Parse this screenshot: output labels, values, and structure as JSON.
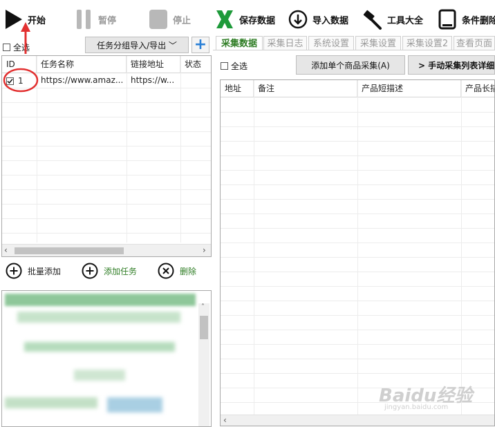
{
  "toolbar": {
    "start": "开始",
    "pause": "暂停",
    "stop": "停止",
    "save": "保存数据",
    "import": "导入数据",
    "tools": "工具大全",
    "conditional_delete": "条件删除"
  },
  "left": {
    "select_all": "全选",
    "group_button": "任务分组导入/导出 ﹀",
    "add_icon": "+",
    "columns": [
      "ID",
      "任务名称",
      "链接地址",
      "状态"
    ],
    "rows": [
      {
        "id": "1",
        "name": "https://www.amaz...",
        "url": "https://w...",
        "status": ""
      }
    ],
    "batch_add": "批量添加",
    "add_task": "添加任务",
    "delete": "删除"
  },
  "right": {
    "tabs": [
      "采集数据",
      "采集日志",
      "系统设置",
      "采集设置",
      "采集设置2",
      "查看页面"
    ],
    "select_all": "全选",
    "add_single": "添加单个商品采集(A)",
    "manual_list": "> 手动采集列表详细",
    "columns": [
      "地址",
      "备注",
      "产品短描述",
      "产品长描"
    ]
  },
  "watermark": {
    "line1": "Baidu经验",
    "line2": "jingyan.baidu.com"
  },
  "colors": {
    "accent_green": "#2f7d25",
    "save_green": "#1e9a3a",
    "annotation_red": "#e23030"
  }
}
